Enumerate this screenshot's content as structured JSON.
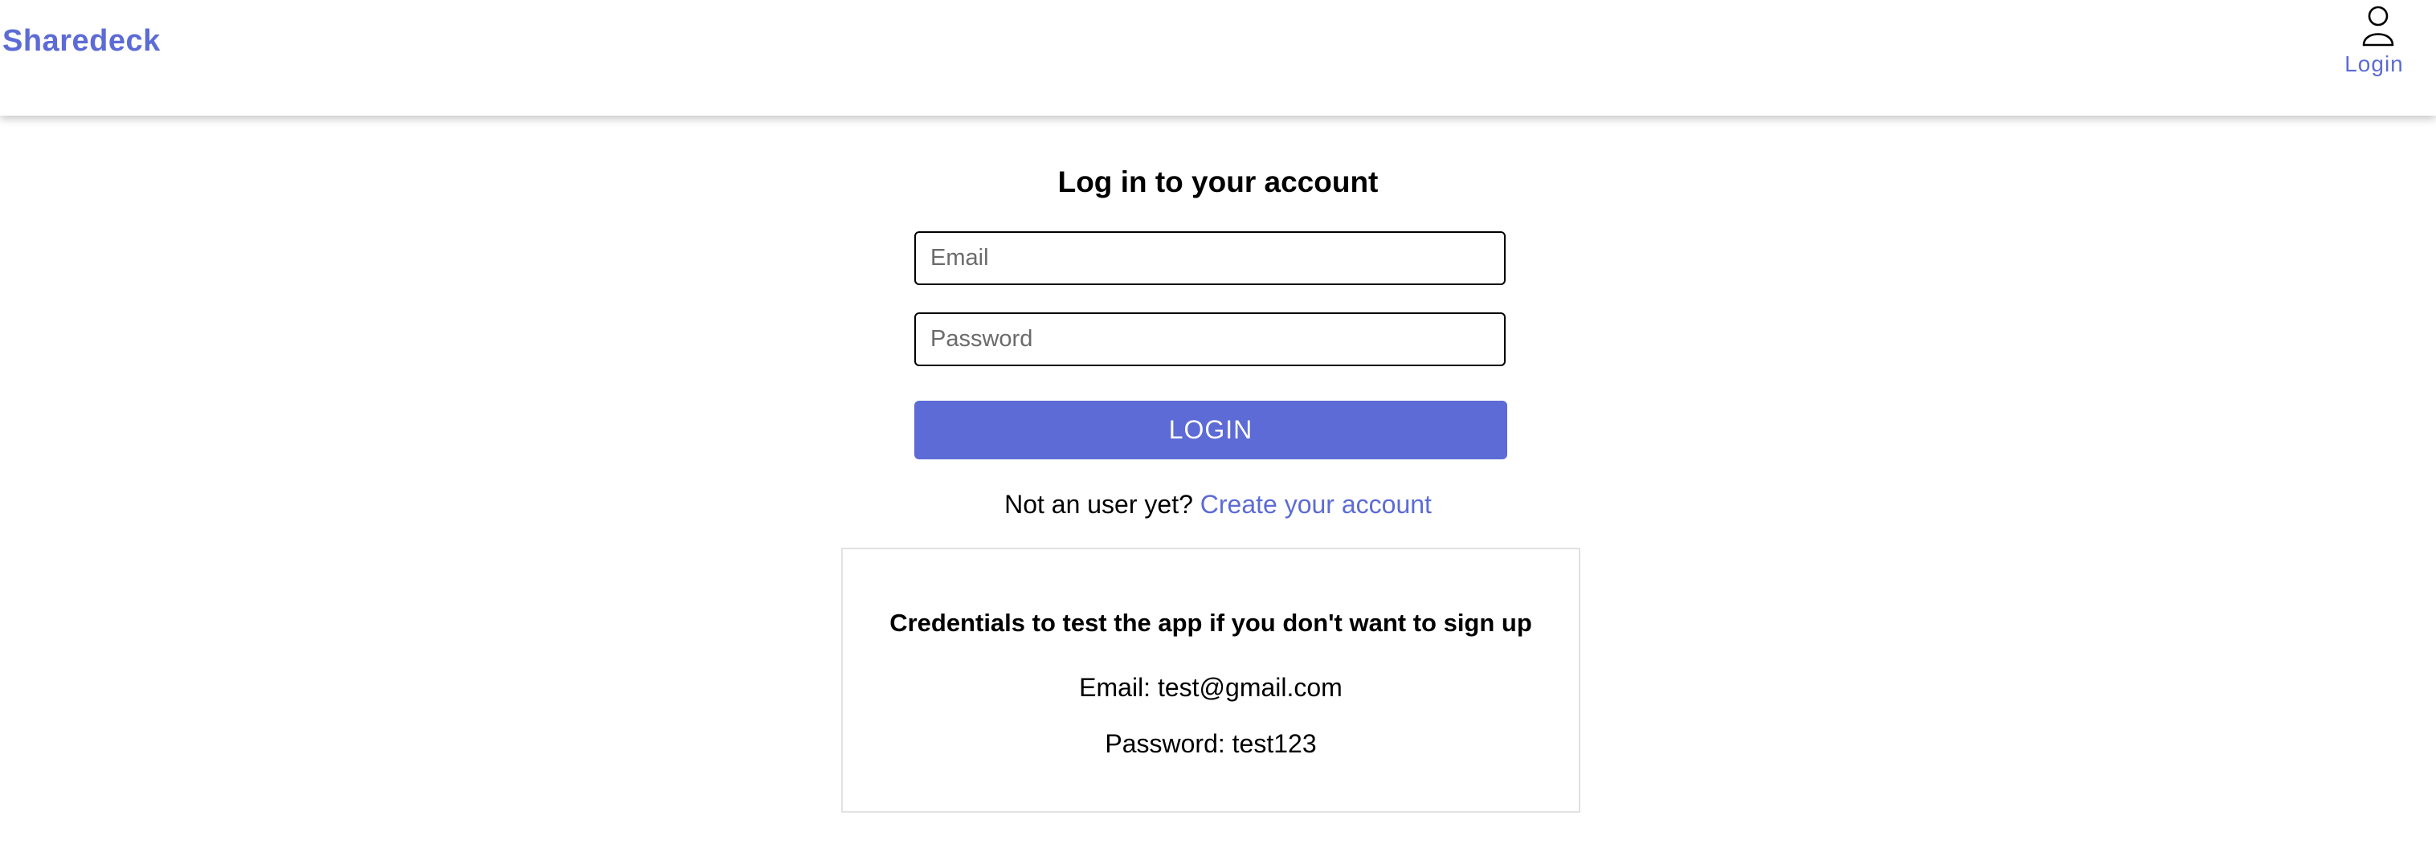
{
  "navbar": {
    "brand": "Sharedeck",
    "login_label": "Login",
    "login_icon": "user-icon"
  },
  "login_form": {
    "title": "Log in to your account",
    "email_placeholder": "Email",
    "email_value": "",
    "password_placeholder": "Password",
    "password_value": "",
    "submit_label": "LOGIN"
  },
  "signup": {
    "prompt": "Not an user yet?",
    "link_label": "Create your account"
  },
  "credentials": {
    "title": "Credentials to test the app if you don't want to sign up",
    "email_line": "Email: test@gmail.com",
    "password_line": "Password: test123"
  },
  "colors": {
    "accent": "#5c6bd5",
    "text": "#000000",
    "card_border": "#e2e2e2"
  }
}
